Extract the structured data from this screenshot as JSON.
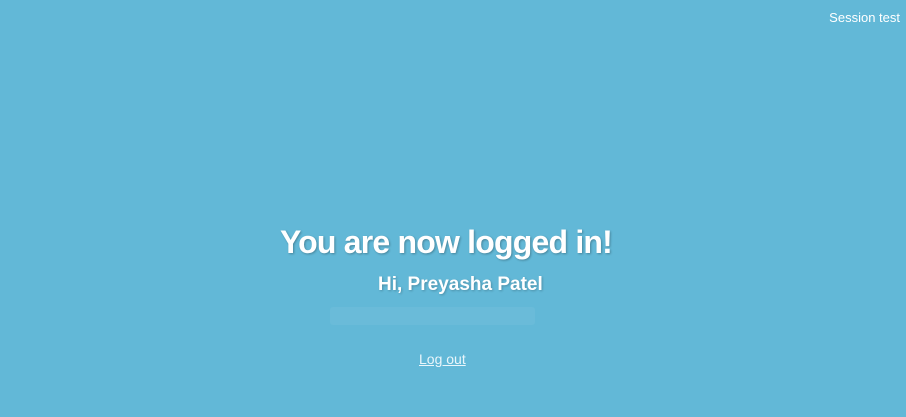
{
  "header": {
    "app_link": "Session test"
  },
  "main": {
    "title": "You are now logged in!",
    "greeting": "Hi, Preyasha Patel",
    "logout_label": "Log out"
  },
  "colors": {
    "background": "#62b8d7",
    "text": "#ffffff"
  }
}
